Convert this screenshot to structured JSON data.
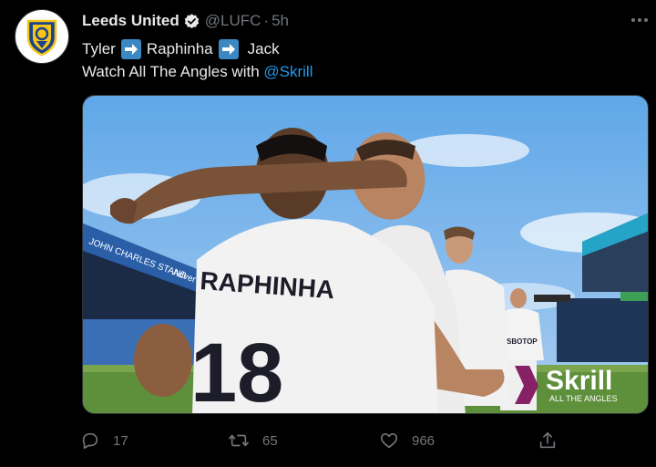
{
  "tweet": {
    "author_name": "Leeds United",
    "handle": "@LUFC",
    "separator": "·",
    "time": "5h",
    "text_line1": {
      "word1": "Tyler",
      "word2": "Raphinha",
      "word3": "Jack"
    },
    "text_line2": {
      "prefix": "Watch All The Angles with ",
      "mention": "@Skrill"
    },
    "media": {
      "stand_sign": "JOHN CHARLES STAND",
      "stand_sign2": "Adver",
      "shirt_name": "RAPHINHA",
      "shirt_number": "18",
      "sponsor_shirt": "SBOTOP",
      "skrill_logo": "Skrill",
      "skrill_tagline": "ALL THE ANGLES"
    },
    "actions": {
      "replies": "17",
      "retweets": "65",
      "likes": "966"
    }
  },
  "colors": {
    "background": "#000000",
    "accent": "#1d9bf0",
    "muted": "#71767b",
    "skrill": "#862165"
  },
  "icons": [
    "verified-badge-icon",
    "more-options-icon",
    "right-arrow-emoji-icon",
    "reply-icon",
    "retweet-icon",
    "like-icon",
    "share-icon"
  ]
}
